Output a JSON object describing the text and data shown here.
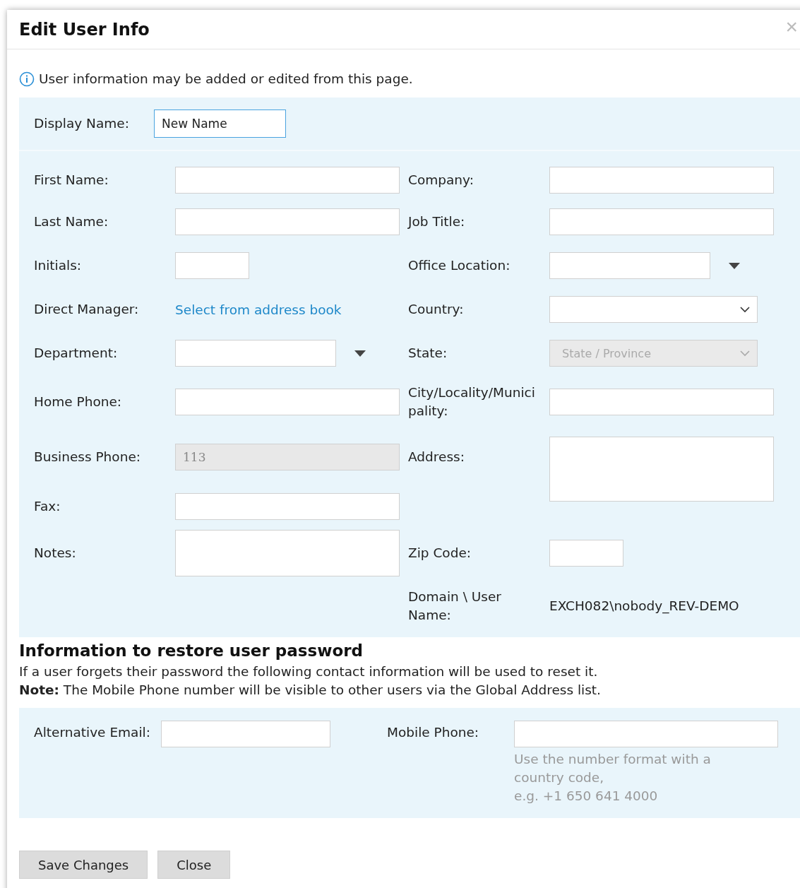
{
  "dialog": {
    "title": "Edit User Info",
    "close": "×"
  },
  "info": "User information may be added or edited from this page.",
  "display_name": {
    "label": "Display Name:",
    "value": "New Name"
  },
  "left_fields": [
    {
      "kind": "text",
      "label": "First Name:"
    },
    {
      "kind": "text",
      "label": "Last Name:"
    },
    {
      "kind": "short",
      "label": "Initials:"
    },
    {
      "kind": "link",
      "label": "Direct Manager:",
      "value": "Select from address book"
    },
    {
      "kind": "combo",
      "label": "Department:"
    },
    {
      "kind": "text",
      "label": "Home Phone:"
    },
    {
      "kind": "text",
      "label": "Business Phone:",
      "value": "113",
      "disabled": true
    },
    {
      "kind": "text",
      "label": "Fax:"
    },
    {
      "kind": "textarea",
      "label": "Notes:"
    }
  ],
  "right_fields": [
    {
      "kind": "text",
      "label": "Company:"
    },
    {
      "kind": "text",
      "label": "Job Title:"
    },
    {
      "kind": "combo",
      "label": "Office Location:"
    },
    {
      "kind": "select",
      "label": "Country:",
      "disabled": false
    },
    {
      "kind": "select",
      "label": "State:",
      "placeholder": "State / Province",
      "disabled": true
    },
    {
      "kind": "text",
      "label": "City/Locality/Municipality:"
    },
    {
      "kind": "textarea",
      "label": "Address:"
    },
    {
      "kind": "short",
      "label": "Zip Code:"
    },
    {
      "kind": "static",
      "label": "Domain \\ User Name:",
      "value": "EXCH082\\nobody_REV-DEMO"
    }
  ],
  "password_section": {
    "heading": "Information to restore user password",
    "description": "If a user forgets their password the following contact information will be used to reset it.",
    "note": "**Note:** The Mobile Phone number will be visible to other users via the Global Address list."
  },
  "recovery_fields": [
    {
      "label": "Alternative Email:"
    },
    {
      "label": "Mobile Phone:",
      "hint": [
        "Use the number format with a",
        "country code,",
        "e.g. +1 650 641 4000"
      ]
    }
  ],
  "buttons": [
    "Save Changes",
    "Close"
  ]
}
